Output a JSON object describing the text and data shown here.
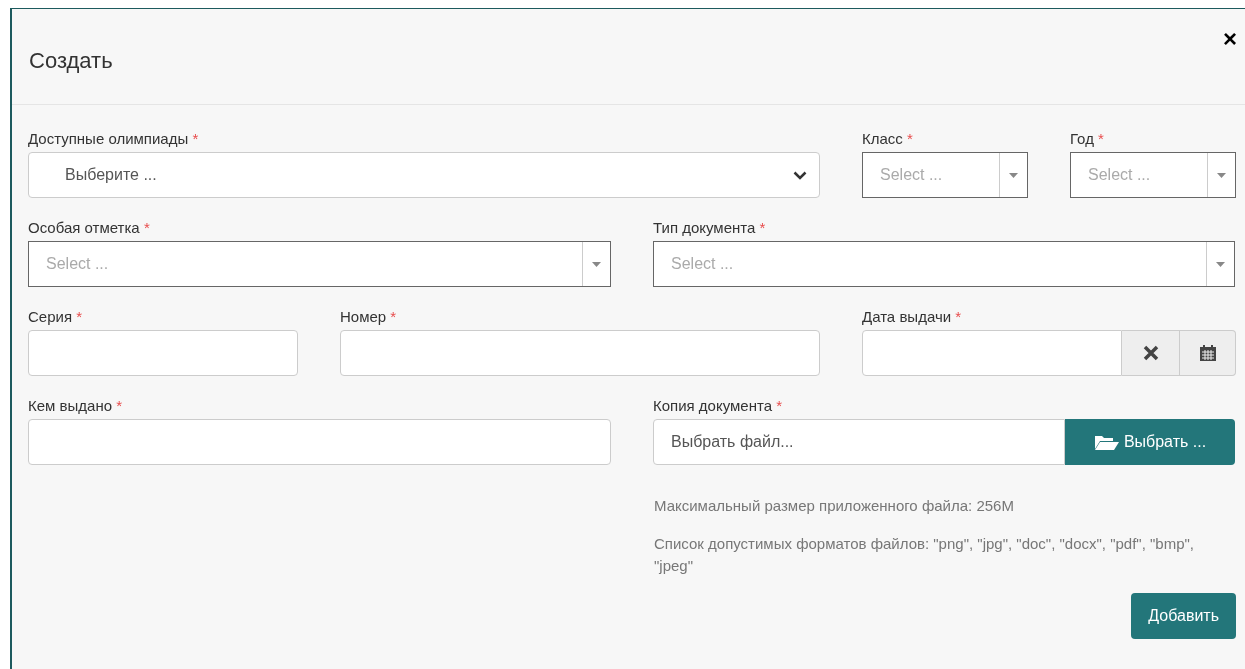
{
  "dialog": {
    "title": "Создать",
    "close": "×"
  },
  "rows": [
    [
      {
        "kind": "native-select",
        "label": "Доступные олимпиады",
        "required_mark": "*",
        "placeholder": "Выберите ..."
      },
      {
        "kind": "select",
        "label": "Класс",
        "required_mark": "*",
        "placeholder": "Select ..."
      },
      {
        "kind": "select",
        "label": "Год",
        "required_mark": "*",
        "placeholder": "Select ..."
      }
    ],
    [
      {
        "kind": "select",
        "label": "Особая отметка",
        "required_mark": "*",
        "placeholder": "Select ..."
      },
      {
        "kind": "select",
        "label": "Тип документа",
        "required_mark": "*",
        "placeholder": "Select ..."
      }
    ],
    [
      {
        "kind": "text",
        "label": "Серия",
        "required_mark": "*"
      },
      {
        "kind": "text",
        "label": "Номер",
        "required_mark": "*"
      },
      {
        "kind": "date",
        "label": "Дата выдачи",
        "required_mark": "*"
      }
    ],
    [
      {
        "kind": "text",
        "label": "Кем выдано",
        "required_mark": "*"
      },
      {
        "kind": "file",
        "label": "Копия документа",
        "required_mark": "*",
        "placeholder": "Выбрать файл...",
        "button": "Выбрать ..."
      }
    ]
  ],
  "hints": [
    "Максимальный размер приложенного файла: 256M",
    "Список допустимых форматов файлов: \"png\", \"jpg\", \"doc\", \"docx\", \"pdf\", \"bmp\", \"jpeg\""
  ],
  "submit": "Добавить"
}
